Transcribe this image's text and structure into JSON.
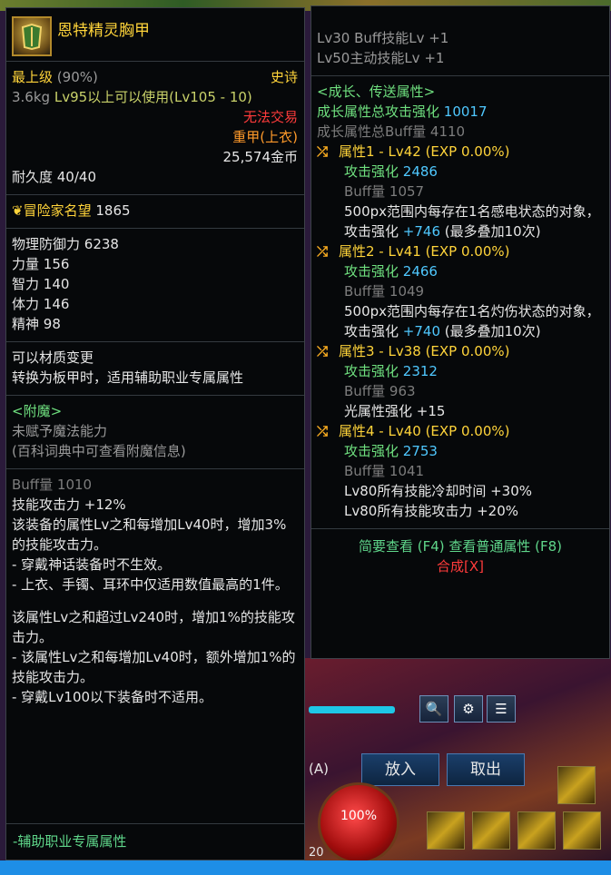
{
  "item": {
    "name": "恩特精灵胸甲",
    "grade": "最上级",
    "grade_pct": "(90%)",
    "rarity": "史诗",
    "weight": "3.6kg",
    "level_req": "Lv95以上可以使用(Lv105 - 10)",
    "trade": "无法交易",
    "type": "重甲(上衣)",
    "price": "25,574金币",
    "durability": "耐久度 40/40"
  },
  "reputation": {
    "label": "冒险家名望",
    "value": "1865"
  },
  "stats": [
    {
      "label": "物理防御力",
      "value": "6238"
    },
    {
      "label": "力量",
      "value": "156"
    },
    {
      "label": "智力",
      "value": "140"
    },
    {
      "label": "体力",
      "value": "146"
    },
    {
      "label": "精神",
      "value": "98"
    }
  ],
  "material": {
    "line1": "可以材质变更",
    "line2": "转换为板甲时，适用辅助职业专属属性"
  },
  "enchant": {
    "title": "<附魔>",
    "line1": "未赋予魔法能力",
    "line2": "(百科词典中可查看附魔信息)"
  },
  "buff": {
    "buff_line": "Buff量 1010",
    "skill_atk": "技能攻击力 +12%",
    "desc1": "该装备的属性Lv之和每增加Lv40时，增加3%的技能攻击力。",
    "desc2": "- 穿戴神话装备时不生效。",
    "desc3": "- 上衣、手镯、耳环中仅适用数值最高的1件。",
    "desc4": "该属性Lv之和超过Lv240时，增加1%的技能攻击力。",
    "desc5": "- 该属性Lv之和每增加Lv40时，额外增加1%的技能攻击力。",
    "desc6": "- 穿戴Lv100以下装备时不适用。",
    "footer": "-辅助职业专属属性"
  },
  "right_top": {
    "line1": "Lv30 Buff技能Lv +1",
    "line2": "Lv50主动技能Lv +1"
  },
  "growth": {
    "title": "<成长、传送属性>",
    "total_atk_label": "成长属性总攻击强化",
    "total_atk_value": "10017",
    "total_buff_label": "成长属性总Buff量",
    "total_buff_value": "4110",
    "attrs": [
      {
        "head": "属性1 - Lv42 (EXP 0.00%)",
        "atk_label": "攻击强化",
        "atk": "2486",
        "buff": "Buff量 1057",
        "extra1": "500px范围内每存在1名感电状态的对象，攻击强化",
        "extra_val": "+746",
        "extra2": "(最多叠加10次)"
      },
      {
        "head": "属性2 - Lv41 (EXP 0.00%)",
        "atk_label": "攻击强化",
        "atk": "2466",
        "buff": "Buff量 1049",
        "extra1": "500px范围内每存在1名灼伤状态的对象，攻击强化",
        "extra_val": "+740",
        "extra2": "(最多叠加10次)"
      },
      {
        "head": "属性3 - Lv38 (EXP 0.00%)",
        "atk_label": "攻击强化",
        "atk": "2312",
        "buff": "Buff量 963",
        "extra1": "光属性强化 +15"
      },
      {
        "head": "属性4 - Lv40 (EXP 0.00%)",
        "atk_label": "攻击强化",
        "atk": "2753",
        "buff": "Buff量 1041",
        "extra1": "Lv80所有技能冷却时间 +30%",
        "extra1b": "Lv80所有技能攻击力 +20%"
      }
    ]
  },
  "footer": {
    "view": "简要查看 (F4) 查看普通属性 (F8)",
    "compose": "合成[X]"
  },
  "hud": {
    "put_in": "放入",
    "take_out": "取出",
    "a_key": "(A)",
    "hp_pct": "100%",
    "level_num": "20"
  },
  "colors": {
    "gold": "#ffd43a",
    "cyan": "#4fc8ff",
    "red": "#ff3b3b",
    "green": "#6fe07f"
  }
}
